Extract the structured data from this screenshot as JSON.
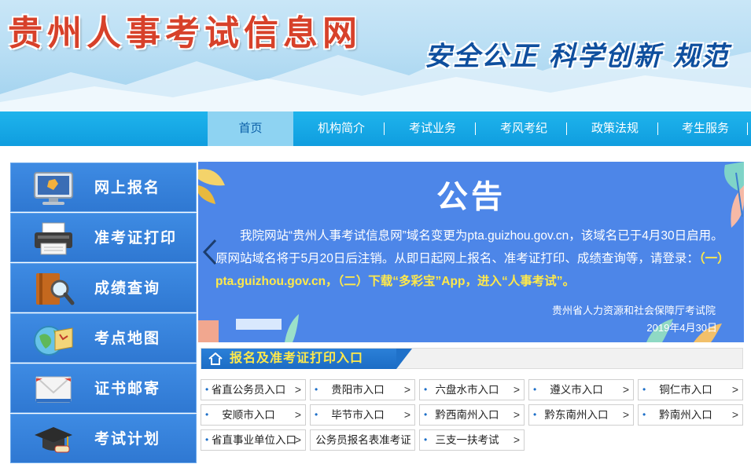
{
  "header": {
    "title": "贵州人事考试信息网",
    "slogan": "安全公正 科学创新 规范"
  },
  "nav": {
    "items": [
      {
        "label": "首页"
      },
      {
        "label": "机构简介"
      },
      {
        "label": "考试业务"
      },
      {
        "label": "考风考纪"
      },
      {
        "label": "政策法规"
      },
      {
        "label": "考生服务"
      }
    ]
  },
  "sidebar": {
    "items": [
      {
        "label": "网上报名",
        "icon": "monitor-icon"
      },
      {
        "label": "准考证打印",
        "icon": "printer-icon"
      },
      {
        "label": "成绩查询",
        "icon": "magnifier-book-icon"
      },
      {
        "label": "考点地图",
        "icon": "globe-map-icon"
      },
      {
        "label": "证书邮寄",
        "icon": "envelope-icon"
      },
      {
        "label": "考试计划",
        "icon": "graduation-cap-icon"
      }
    ]
  },
  "notice": {
    "title": "公告",
    "body_1": "我院网站“贵州人事考试信息网”域名变更为pta.guizhou.gov.cn，该域名已于4月30日启用。原网站域名将于5月20日后注销。从即日起网上报名、准考证打印、成绩查询等，请登录：",
    "body_highlight": "（一）pta.guizhou.gov.cn，（二）下载“多彩宝”App，进入“人事考试”。",
    "org": "贵州省人力资源和社会保障厅考试院",
    "date": "2019年4月30日"
  },
  "entry": {
    "title": "报名及准考证打印入口",
    "buttons": [
      "省直公务员入口",
      "贵阳市入口",
      "六盘水市入口",
      "遵义市入口",
      "铜仁市入口",
      "安顺市入口",
      "毕节市入口",
      "黔西南州入口",
      "黔东南州入口",
      "黔南州入口",
      "省直事业单位入口",
      "公务员报名表准考证",
      "三支一扶考试"
    ]
  },
  "colors": {
    "nav_bg": "#12a5e4",
    "sidebar_bg": "#3680da",
    "notice_bg": "#4d86e8",
    "highlight": "#ffe94a",
    "title_red": "#d7412a"
  }
}
